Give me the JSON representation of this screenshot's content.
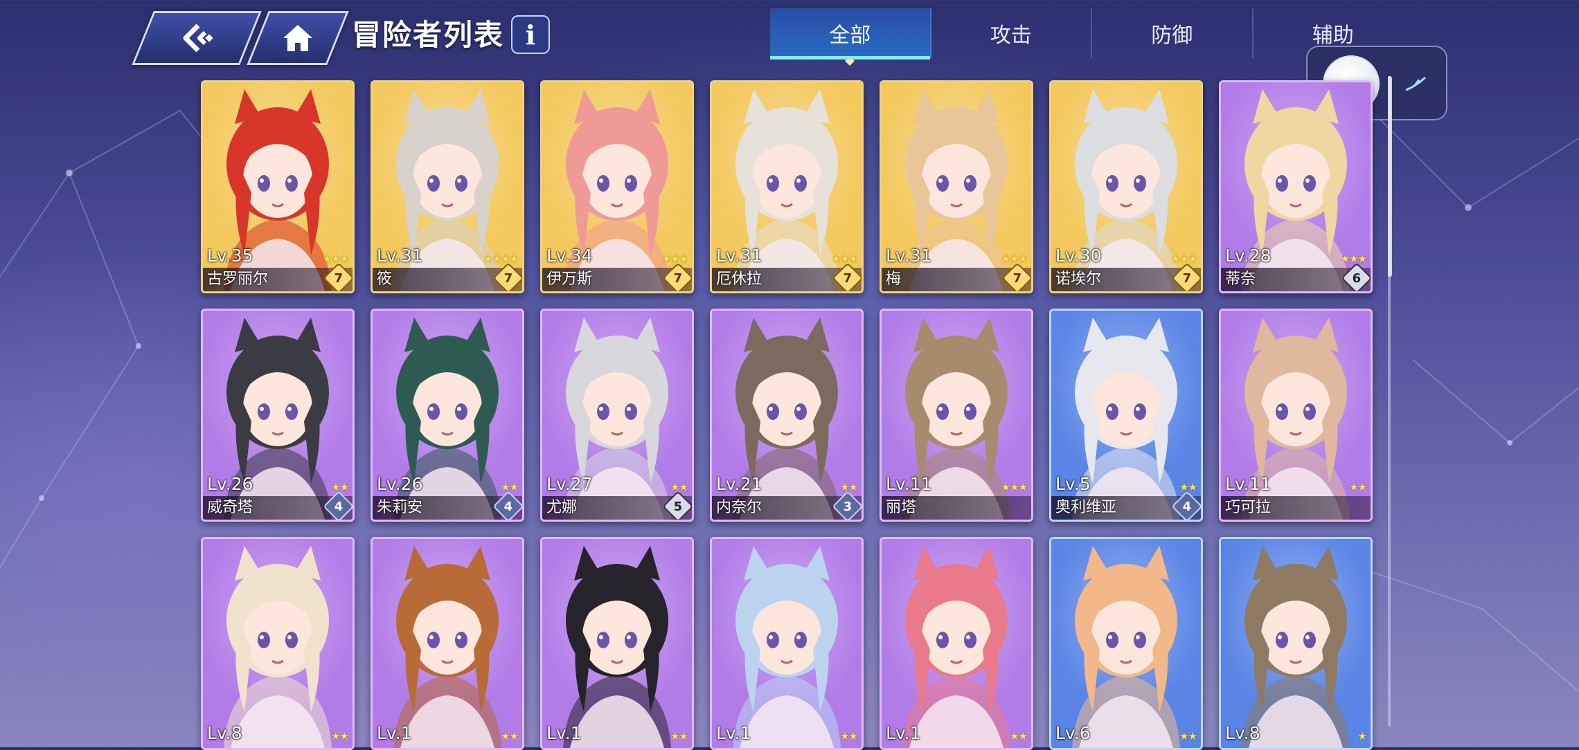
{
  "header": {
    "title": "冒险者列表",
    "info_label": "i"
  },
  "tabs": [
    {
      "label": "全部",
      "active": true
    },
    {
      "label": "攻击",
      "active": false
    },
    {
      "label": "防御",
      "active": false
    },
    {
      "label": "辅助",
      "active": false
    }
  ],
  "icons": {
    "back": "back-arrow-icon",
    "home": "home-icon",
    "info": "info-icon",
    "shortcut": "feather-icon"
  },
  "colors": {
    "gold_card": "#f3c85d",
    "purple_card": "#b27ce8",
    "blue_card": "#5a85e6",
    "tab_active": "#2f6bc0",
    "tab_accent": "#7ff0ff"
  },
  "cards": [
    {
      "level": "Lv.35",
      "name": "古罗丽尔",
      "stars": "★★★",
      "rank": "7",
      "rarity": "gold",
      "hair": "#d8362a"
    },
    {
      "level": "Lv.31",
      "name": "筱",
      "stars": "★★★★",
      "rank": "7",
      "rarity": "gold",
      "hair": "#d7d3cc"
    },
    {
      "level": "Lv.34",
      "name": "伊万斯",
      "stars": "★★★",
      "rank": "7",
      "rarity": "gold",
      "hair": "#ef9a96"
    },
    {
      "level": "Lv.31",
      "name": "厄休拉",
      "stars": "★★★",
      "rank": "7",
      "rarity": "gold",
      "hair": "#e6e1d9"
    },
    {
      "level": "Lv.31",
      "name": "梅",
      "stars": "★★★",
      "rank": "7",
      "rarity": "gold",
      "hair": "#e9c59a"
    },
    {
      "level": "Lv.30",
      "name": "诺埃尔",
      "stars": "★★★",
      "rank": "7",
      "rarity": "gold",
      "hair": "#dcdde0"
    },
    {
      "level": "Lv.28",
      "name": "蒂奈",
      "stars": "★★★",
      "rank": "6",
      "rarity": "purple",
      "hair": "#efd7a2"
    },
    {
      "level": "Lv.26",
      "name": "威奇塔",
      "stars": "★★",
      "rank": "4",
      "rarity": "purple",
      "hair": "#3b3b44"
    },
    {
      "level": "Lv.26",
      "name": "朱莉安",
      "stars": "★★",
      "rank": "4",
      "rarity": "purple",
      "hair": "#2f5a52"
    },
    {
      "level": "Lv.27",
      "name": "尤娜",
      "stars": "★★",
      "rank": "5",
      "rarity": "purple",
      "hair": "#d7d7dc"
    },
    {
      "level": "Lv.21",
      "name": "内奈尔",
      "stars": "★★",
      "rank": "3",
      "rarity": "purple",
      "hair": "#7c6a5e"
    },
    {
      "level": "Lv.11",
      "name": "丽塔",
      "stars": "★★★",
      "rank": "",
      "rarity": "purple",
      "hair": "#a88a6c"
    },
    {
      "level": "Lv.5",
      "name": "奥利维亚",
      "stars": "★★",
      "rank": "4",
      "rarity": "blue",
      "hair": "#e7e8ee"
    },
    {
      "level": "Lv.11",
      "name": "巧可拉",
      "stars": "★★",
      "rank": "",
      "rarity": "purple",
      "hair": "#e0b89e"
    },
    {
      "level": "Lv.8",
      "name": "",
      "stars": "★★",
      "rank": "",
      "rarity": "purple",
      "hair": "#f0e2cc"
    },
    {
      "level": "Lv.1",
      "name": "",
      "stars": "★★",
      "rank": "",
      "rarity": "purple",
      "hair": "#b86a37"
    },
    {
      "level": "Lv.1",
      "name": "",
      "stars": "★★",
      "rank": "",
      "rarity": "purple",
      "hair": "#26232b"
    },
    {
      "level": "Lv.1",
      "name": "",
      "stars": "★★",
      "rank": "",
      "rarity": "purple",
      "hair": "#bcd3f0"
    },
    {
      "level": "Lv.1",
      "name": "",
      "stars": "★★",
      "rank": "",
      "rarity": "purple",
      "hair": "#e87a8c"
    },
    {
      "level": "Lv.6",
      "name": "",
      "stars": "★★",
      "rank": "",
      "rarity": "blue",
      "hair": "#f2b88a"
    },
    {
      "level": "Lv.8",
      "name": "",
      "stars": "★",
      "rank": "",
      "rarity": "blue",
      "hair": "#8e7a62"
    }
  ]
}
